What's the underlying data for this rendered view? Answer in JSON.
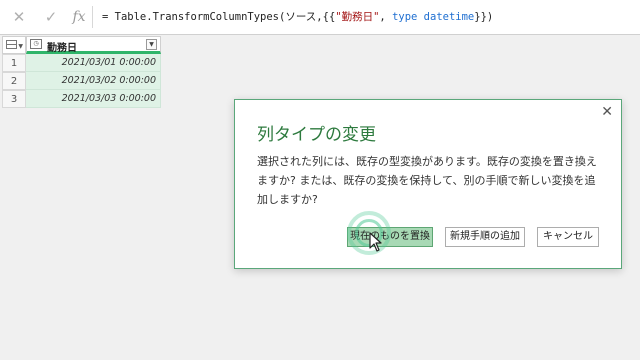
{
  "formula_bar": {
    "cancel_icon": "close-icon",
    "confirm_icon": "check-icon",
    "fx_label": "fx",
    "formula_prefix": "= Table.TransformColumnTypes(ソース,{{",
    "formula_string": "\"勤務日\"",
    "formula_sep": ", ",
    "formula_keyword": "type datetime",
    "formula_suffix": "}})"
  },
  "table": {
    "column_header": "勤務日",
    "rows": [
      {
        "num": "1",
        "value": "2021/03/01 0:00:00"
      },
      {
        "num": "2",
        "value": "2021/03/02 0:00:00"
      },
      {
        "num": "3",
        "value": "2021/03/03 0:00:00"
      }
    ]
  },
  "dialog": {
    "title": "列タイプの変更",
    "message": "選択された列には、既存の型変換があります。既存の変換を置き換えますか? または、既存の変換を保持して、別の手順で新しい変換を追加しますか?",
    "replace_button": "現在のものを置換",
    "add_step_button": "新規手順の追加",
    "cancel_button": "キャンセル",
    "close_glyph": "✕"
  },
  "colors": {
    "accent": "#2fb56a",
    "title": "#2d7a3e",
    "cell_bg": "#dff2e6",
    "primary_button": "#a8d9b5"
  }
}
